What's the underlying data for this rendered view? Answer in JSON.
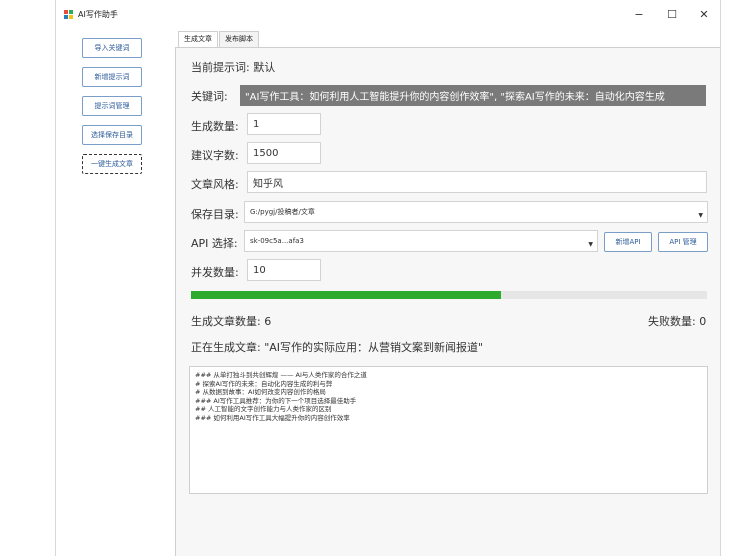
{
  "window": {
    "title": "AI写作助手",
    "minimize": "−",
    "maximize": "☐",
    "close": "✕"
  },
  "sidebar": {
    "items": [
      {
        "label": "导入关键词"
      },
      {
        "label": "新增提示词"
      },
      {
        "label": "提示词管理"
      },
      {
        "label": "选择保存目录"
      },
      {
        "label": "一键生成文章"
      }
    ]
  },
  "tabs": [
    {
      "label": "生成文章"
    },
    {
      "label": "发布脚本"
    }
  ],
  "form": {
    "prompt_label": "当前提示词: 默认",
    "keywords_label": "关键词:",
    "keywords_value": "\"AI写作工具：如何利用人工智能提升你的内容创作效率\", \"探索AI写作的未来：自动化内容生成",
    "count_label": "生成数量:",
    "count_value": "1",
    "words_label": "建议字数:",
    "words_value": "1500",
    "style_label": "文章风格:",
    "style_value": "知乎风",
    "save_label": "保存目录:",
    "save_value": "G:/pygj/投稿者/文章",
    "api_label": "API 选择:",
    "api_value": "sk-09c5a...afa3",
    "new_api_label": "新增API",
    "api_manage_label": "API 管理",
    "concurrency_label": "并发数量:",
    "concurrency_value": "10"
  },
  "progress": {
    "fraction": 0.6
  },
  "status": {
    "generated": "生成文章数量: 6",
    "failed": "失败数量: 0",
    "current": "正在生成文章: \"AI写作的实际应用：从营销文案到新闻报道\""
  },
  "log": [
    "### 从单打独斗到共创辉煌 —— AI与人类作家的合作之道",
    "# 探索AI写作的未来：自动化内容生成的利与弊",
    "# 从数据到故事：AI如何改变内容创作的格局",
    "### AI写作工具推荐：为你的下一个项目选择最佳助手",
    "## 人工智能的文字创作能力与人类作家的区别",
    "### 如何利用AI写作工具大幅提升你的内容创作效率"
  ],
  "colors": {
    "accent": "#7a9ec8",
    "progress": "#2eaa2e"
  }
}
